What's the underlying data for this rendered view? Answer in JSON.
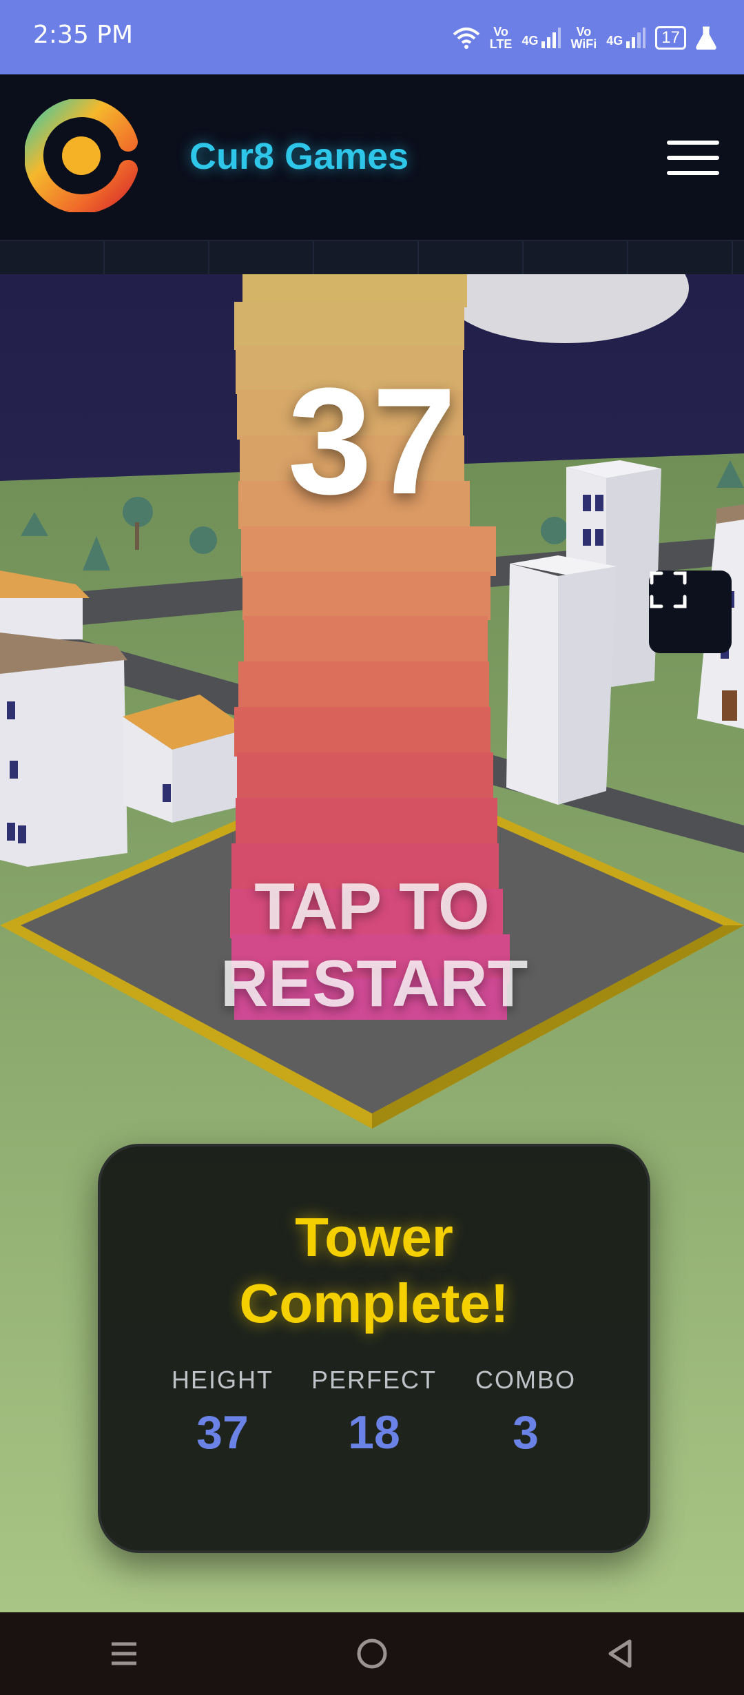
{
  "status_bar": {
    "time": "2:35 PM",
    "volte_top": "Vo",
    "volte_bottom": "LTE",
    "net1": "4G",
    "vowifi_top": "Vo",
    "vowifi_bottom": "WiFi",
    "net2": "4G",
    "battery": "17"
  },
  "header": {
    "brand": "Cur8 Games",
    "logo_icon": "cur8-logo-icon",
    "menu_icon": "hamburger-menu-icon"
  },
  "game": {
    "score": "37",
    "restart_text": "TAP TO RESTART",
    "fullscreen_icon": "fullscreen-icon"
  },
  "results": {
    "title": "Tower Complete!",
    "stats": [
      {
        "label": "HEIGHT",
        "value": "37"
      },
      {
        "label": "PERFECT",
        "value": "18"
      },
      {
        "label": "COMBO",
        "value": "3"
      }
    ]
  },
  "nav": {
    "recents_icon": "recents-icon",
    "home_icon": "home-icon",
    "back_icon": "back-icon"
  },
  "colors": {
    "status_bar": "#6b7fe6",
    "brand": "#2ec7ea",
    "title": "#f5d000",
    "stat_value": "#6b83e6"
  }
}
